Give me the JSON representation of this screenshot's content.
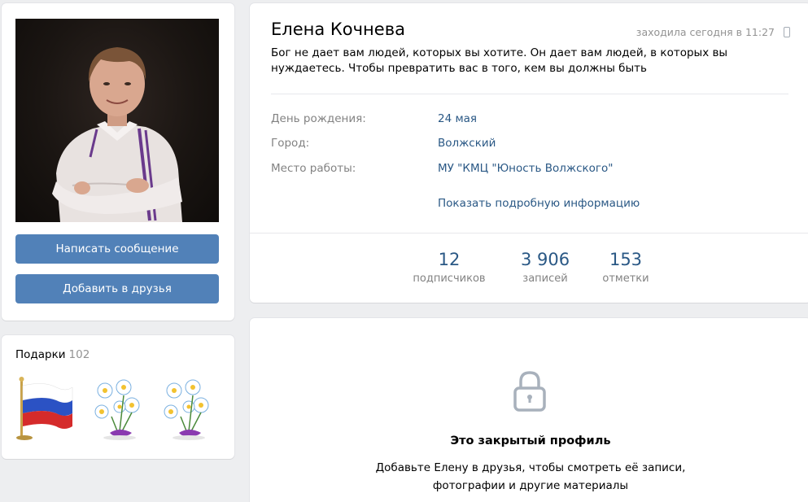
{
  "profile": {
    "name": "Елена Кочнева",
    "last_seen": "заходила сегодня в 11:27",
    "status": "Бог не дает вам людей, которых вы хотите. Он дает вам людей, в которых вы нуждаетесь. Чтобы превратить вас в того, кем вы должны быть",
    "info": [
      {
        "label": "День рождения:",
        "value": "24 мая"
      },
      {
        "label": "Город:",
        "value": "Волжский"
      },
      {
        "label": "Место работы:",
        "value": "МУ \"КМЦ \"Юность Волжского\""
      }
    ],
    "more_info": "Показать подробную информацию",
    "counters": [
      {
        "value": "12",
        "label": "подписчиков"
      },
      {
        "value": "3 906",
        "label": "записей"
      },
      {
        "value": "153",
        "label": "отметки"
      }
    ]
  },
  "actions": {
    "message": "Написать сообщение",
    "add_friend": "Добавить в друзья"
  },
  "gifts": {
    "title": "Подарки",
    "count": "102",
    "items": [
      "russian-flag-gift",
      "daisies-gift",
      "daisies-gift"
    ]
  },
  "closed_profile": {
    "title": "Это закрытый профиль",
    "text": "Добавьте Елену в друзья, чтобы смотреть её записи, фотографии и другие материалы"
  },
  "colors": {
    "accent": "#5181b8",
    "link": "#2a5885",
    "muted": "#828282",
    "background": "#edeef0"
  },
  "icons": {
    "phone": "mobile-phone-icon",
    "lock": "lock-icon"
  }
}
